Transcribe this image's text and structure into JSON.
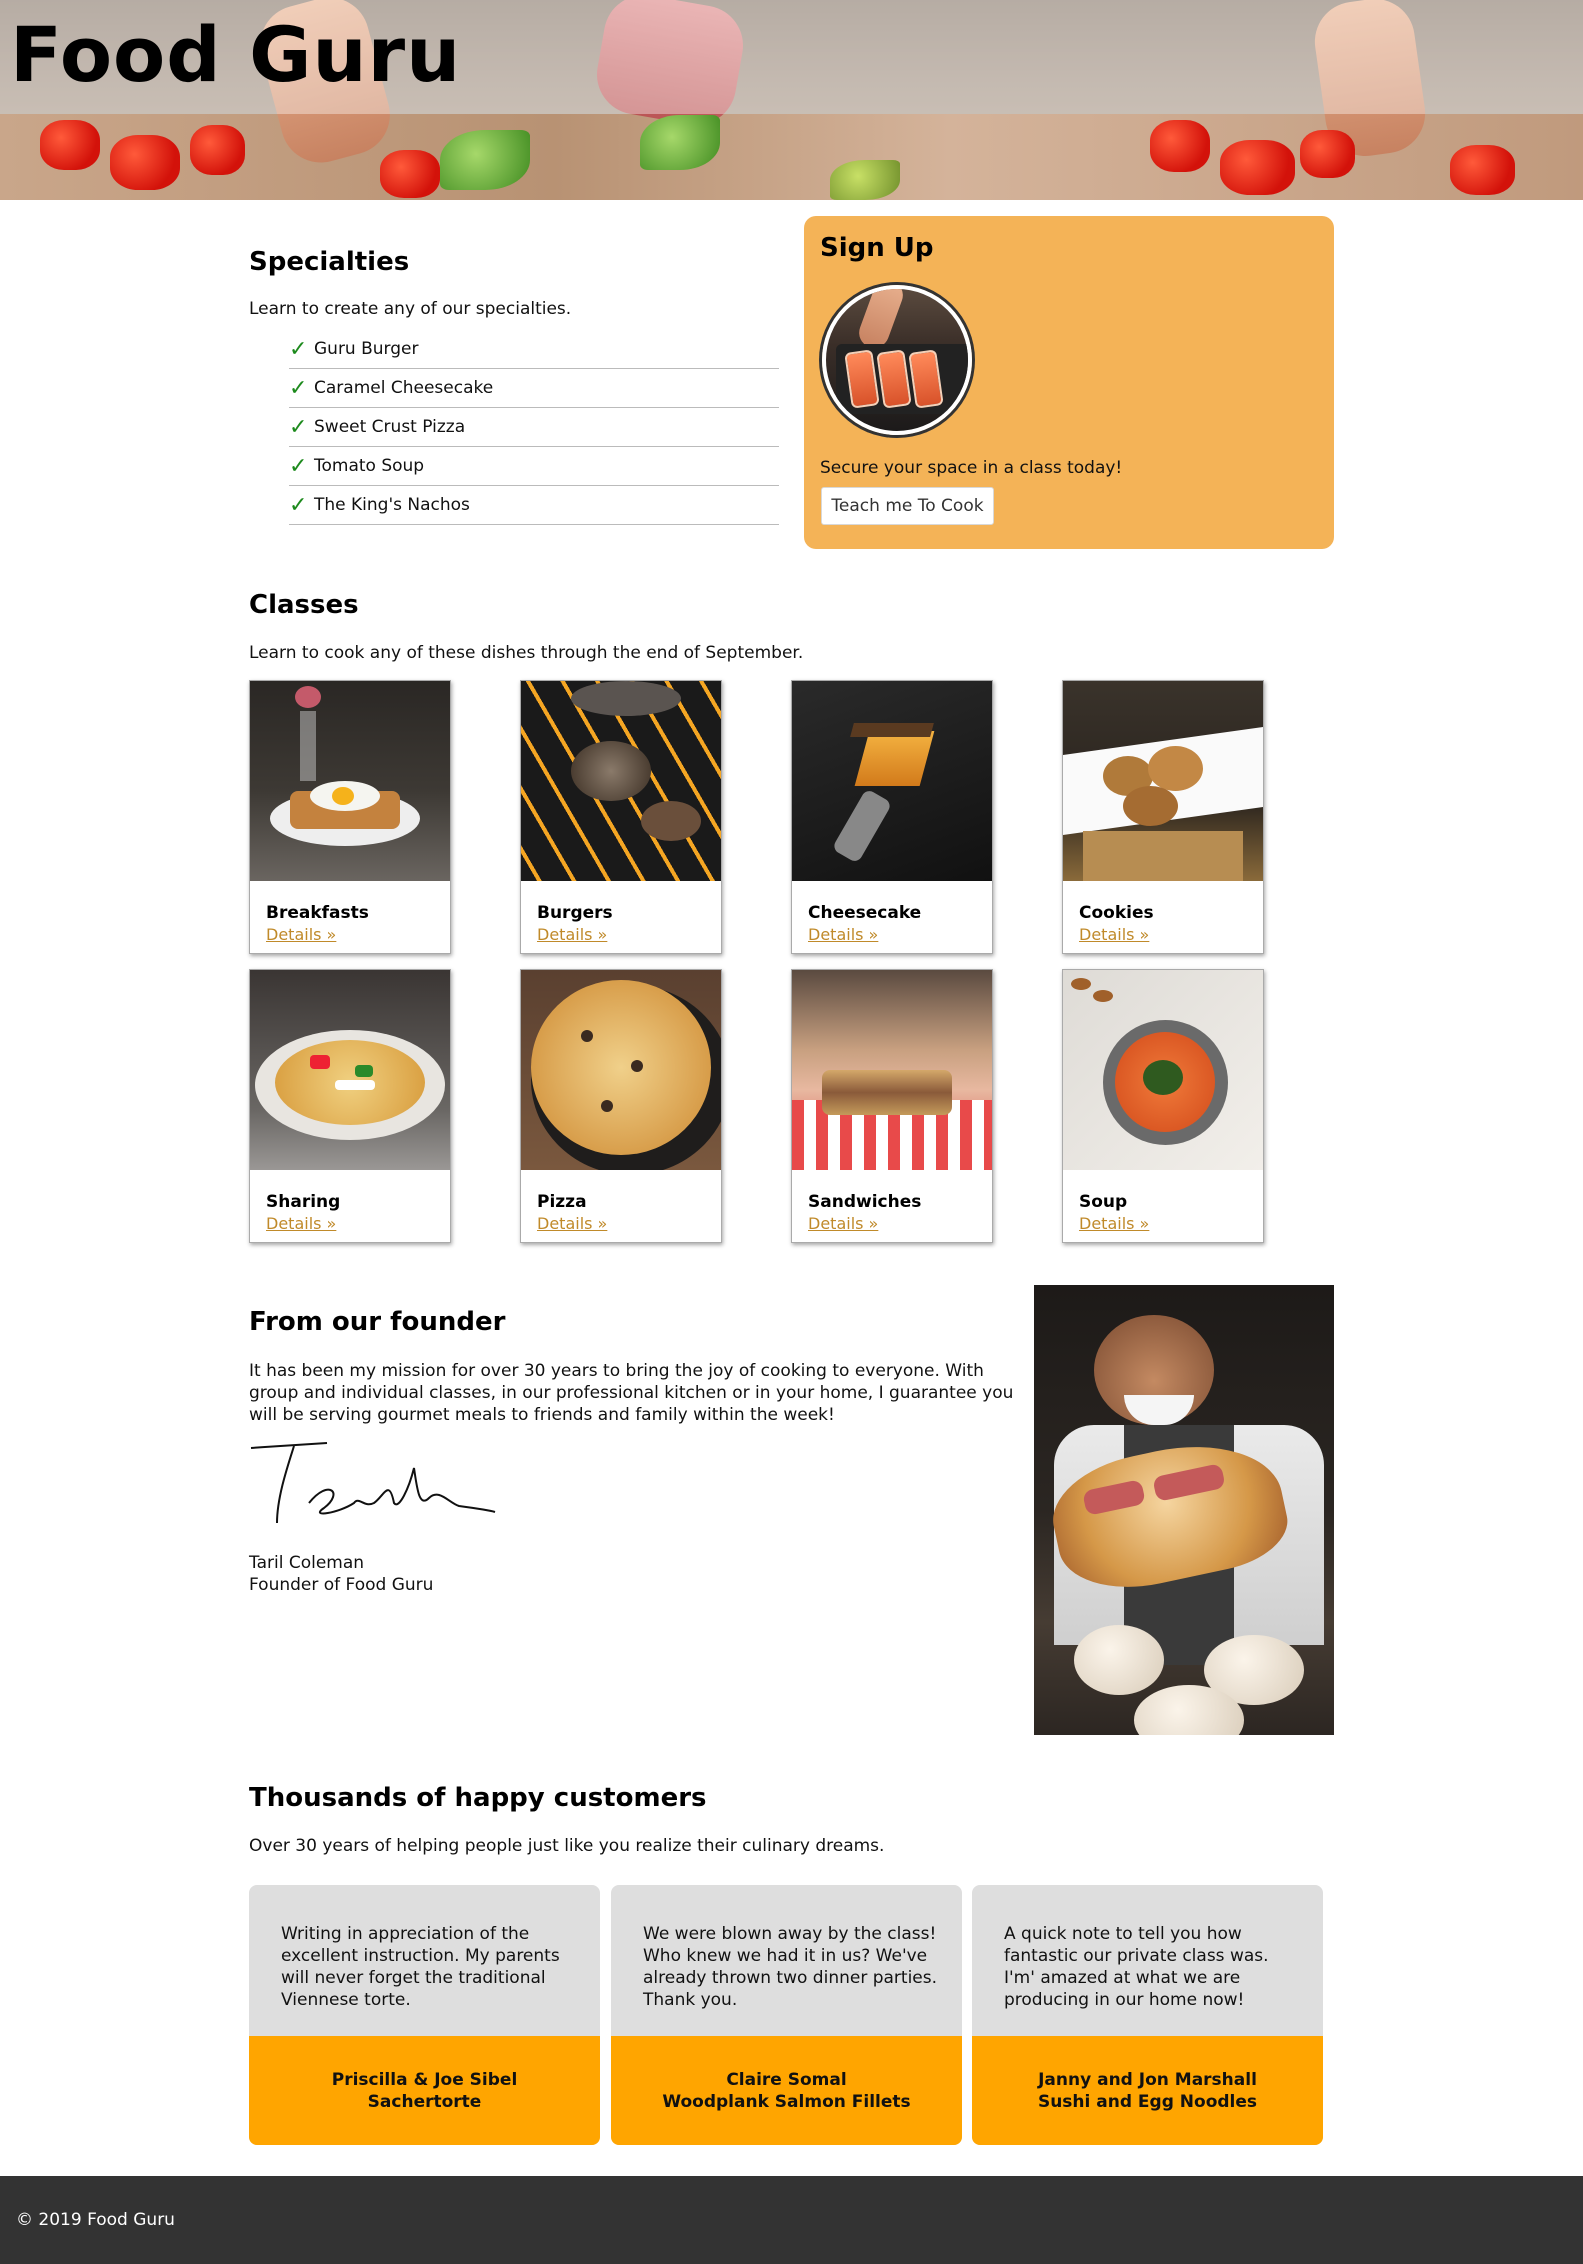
{
  "site": {
    "title": "Food Guru"
  },
  "specialties": {
    "heading": "Specialties",
    "intro": "Learn to create any of our specialties.",
    "items": [
      "Guru Burger",
      "Caramel Cheesecake",
      "Sweet Crust Pizza",
      "Tomato Soup",
      "The King's Nachos"
    ],
    "check_icon": "checkmark-icon",
    "check_color": "#1d8a1d"
  },
  "signup": {
    "heading": "Sign Up",
    "text": "Secure your space in a class today!",
    "button_label": "Teach me To Cook",
    "bg_color": "#f4b357"
  },
  "classes": {
    "heading": "Classes",
    "intro": "Learn to cook any of these dishes through the end of September.",
    "details_label": "Details »",
    "link_color": "#c08a2a",
    "cards": [
      {
        "title": "Breakfasts"
      },
      {
        "title": "Burgers"
      },
      {
        "title": "Cheesecake"
      },
      {
        "title": "Cookies"
      },
      {
        "title": "Sharing"
      },
      {
        "title": "Pizza"
      },
      {
        "title": "Sandwiches"
      },
      {
        "title": "Soup"
      }
    ]
  },
  "founder": {
    "heading": "From our founder",
    "text": "It has been my mission for over 30 years to bring the joy of cooking to everyone. With group and individual classes, in our professional kitchen or in your home, I guarantee you will be serving gourmet meals to friends and family within the week!",
    "name": "Taril Coleman",
    "role": "Founder of Food Guru"
  },
  "customers": {
    "heading": "Thousands of happy customers",
    "intro": "Over 30 years of helping people just like you realize their culinary dreams.",
    "accent_color": "#ffa500",
    "testimonials": [
      {
        "quote": "Writing in appreciation of the excellent instruction. My parents will never forget the traditional Viennese torte.",
        "name": "Priscilla & Joe Sibel",
        "dish": "Sachertorte"
      },
      {
        "quote": "We were blown away by the class! Who knew we had it in us? We've already thrown two dinner parties. Thank you.",
        "name": "Claire Somal",
        "dish": "Woodplank Salmon Fillets"
      },
      {
        "quote": "A quick note to tell you how fantastic our private class was. I'm' amazed at what we are producing in our home now!",
        "name": "Janny and Jon Marshall",
        "dish": "Sushi and Egg Noodles"
      }
    ]
  },
  "footer": {
    "text": "© 2019 Food Guru"
  }
}
